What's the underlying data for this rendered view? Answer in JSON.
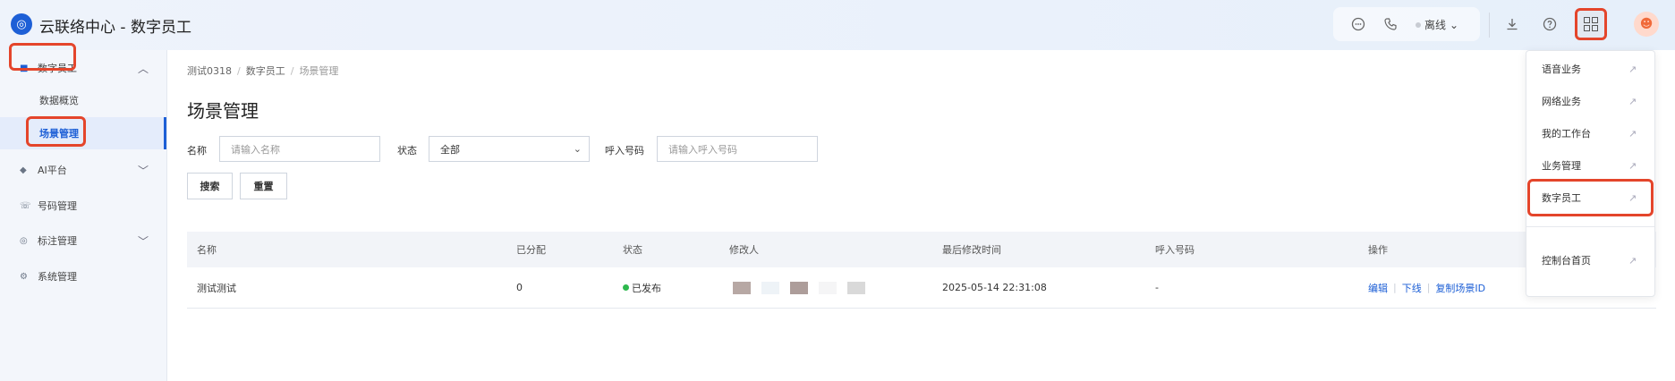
{
  "header": {
    "logo_glyph": "◎",
    "title": "云联络中心 - 数字员工",
    "status_label": "离线",
    "avatar_glyph": "☻"
  },
  "sidebar": {
    "items": [
      {
        "label": "数字员工",
        "icon": "robot-icon",
        "glyph": "■",
        "expanded": true
      },
      {
        "label": "AI平台",
        "icon": "ai-icon",
        "glyph": "◆",
        "expanded": false
      },
      {
        "label": "号码管理",
        "icon": "phone-icon",
        "glyph": "☏"
      },
      {
        "label": "标注管理",
        "icon": "tag-icon",
        "glyph": "◎",
        "expanded": false
      },
      {
        "label": "系统管理",
        "icon": "gear-icon",
        "glyph": "⚙"
      }
    ],
    "sub_items": [
      {
        "label": "数据概览"
      },
      {
        "label": "场景管理",
        "active": true
      }
    ]
  },
  "main": {
    "breadcrumb": [
      "测试0318",
      "数字员工",
      "场景管理"
    ],
    "title": "场景管理",
    "filters": {
      "name_label": "名称",
      "name_placeholder": "请输入名称",
      "status_label": "状态",
      "status_value": "全部",
      "number_label": "呼入号码",
      "number_placeholder": "请输入呼入号码"
    },
    "buttons": {
      "search": "搜索",
      "reset": "重置"
    },
    "table": {
      "columns": [
        "名称",
        "已分配",
        "状态",
        "修改人",
        "最后修改时间",
        "呼入号码",
        "操作"
      ],
      "rows": [
        {
          "name": "测试测试",
          "assigned": "0",
          "status": "已发布",
          "modifier_swatches": [
            "#b7a8a4",
            "#eef3f7",
            "#ad9d9a",
            "#f5f5f6",
            "#d9d9d9"
          ],
          "last_modified": "2025-05-14 22:31:08",
          "inbound_number": "-",
          "actions": [
            "编辑",
            "下线",
            "复制场景ID"
          ]
        }
      ]
    }
  },
  "dropdown": {
    "items": [
      {
        "label": "语音业务"
      },
      {
        "label": "网络业务"
      },
      {
        "label": "我的工作台"
      },
      {
        "label": "业务管理"
      },
      {
        "label": "数字员工"
      },
      {
        "label": "控制台首页"
      }
    ],
    "ext_glyph": "↗"
  },
  "colors": {
    "accent": "#1d5fd6",
    "highlight_box": "#e4452b",
    "success": "#2db84d"
  }
}
